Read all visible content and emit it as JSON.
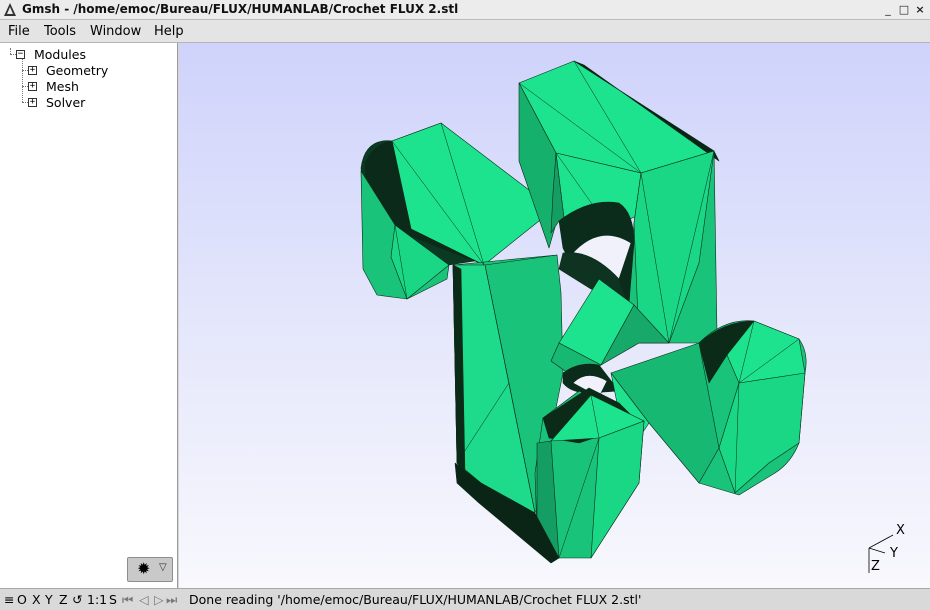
{
  "window": {
    "title": "Gmsh - /home/emoc/Bureau/FLUX/HUMANLAB/Crochet FLUX 2.stl",
    "controls": [
      "_",
      "□",
      "×"
    ]
  },
  "menubar": {
    "file": "File",
    "tools": "Tools",
    "window": "Window",
    "help": "Help"
  },
  "tree": {
    "root": {
      "label": "Modules",
      "toggle": "−"
    },
    "children": [
      {
        "label": "Geometry",
        "toggle": "+"
      },
      {
        "label": "Mesh",
        "toggle": "+"
      },
      {
        "label": "Solver",
        "toggle": "+"
      }
    ]
  },
  "plugin_button": {
    "icon": "gear-icon",
    "dropdown": "▽"
  },
  "viewport": {
    "background_top": "#cfd3fb",
    "background_bottom": "#f8f8fd",
    "model_color": "#1de38e",
    "axes": {
      "x": "X",
      "y": "Y",
      "z": "Z"
    }
  },
  "statusbar": {
    "menu_icon": "≡",
    "o": "O",
    "x": "X",
    "y": "Y",
    "z": "Z",
    "rotate_icon": "↺",
    "scale": "1:1",
    "s": "S",
    "nav_first": "⏮",
    "nav_prev": "◁",
    "nav_next": "▷",
    "nav_last": "⏭",
    "message": "Done reading '/home/emoc/Bureau/FLUX/HUMANLAB/Crochet FLUX 2.stl'"
  }
}
